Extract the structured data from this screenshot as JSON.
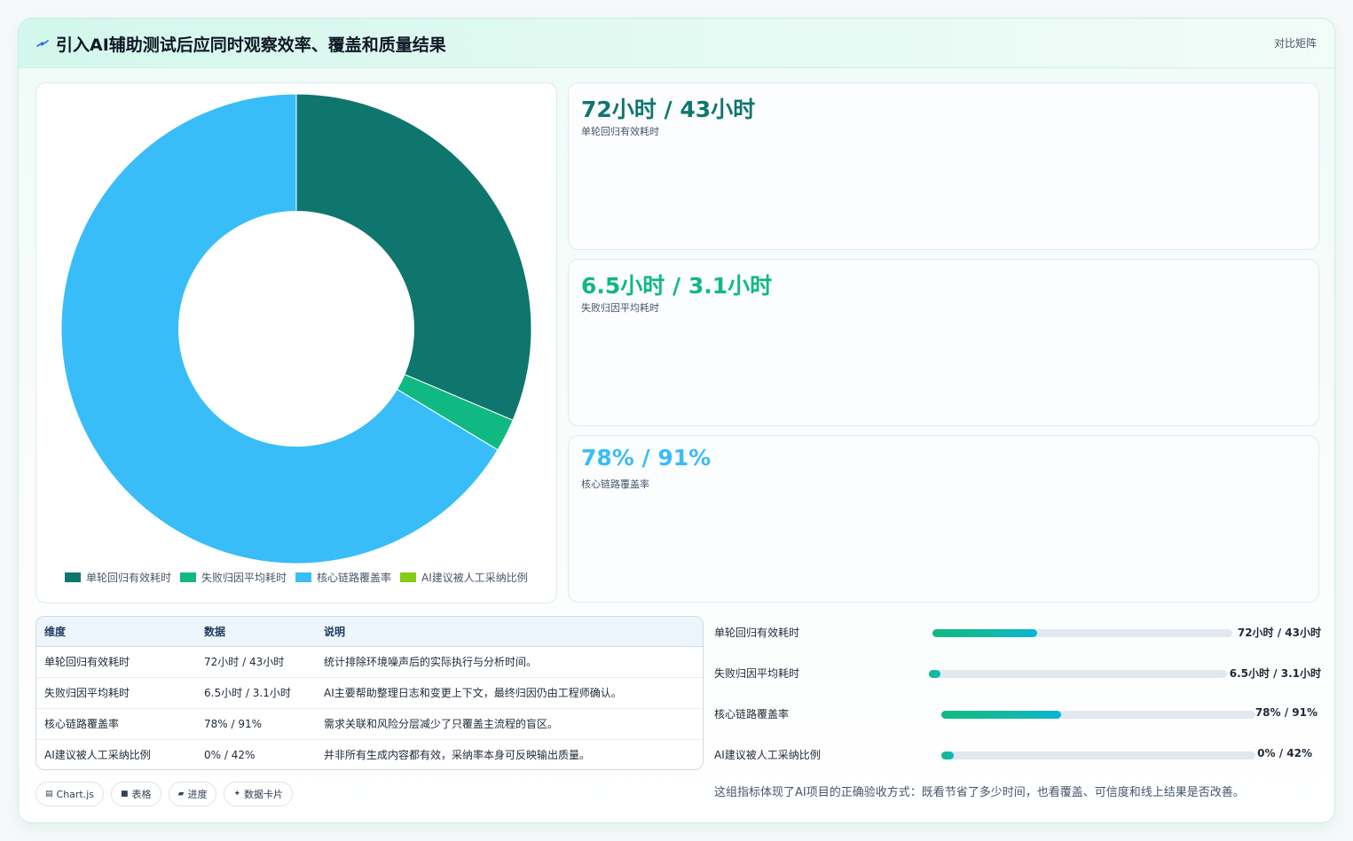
{
  "header": {
    "title": "引入AI辅助测试后应同时观察效率、覆盖和质量结果",
    "tag": "对比矩阵"
  },
  "colors": {
    "teal_dark": "#0f766e",
    "emerald": "#10b981",
    "sky": "#38bdf8",
    "lime": "#84cc16"
  },
  "chart_data": {
    "type": "pie",
    "categories": [
      "单轮回归有效耗时",
      "失败归因平均耗时",
      "核心链路覆盖率",
      "AI建议被人工采纳比例"
    ],
    "values": [
      43,
      3.1,
      91,
      0
    ],
    "colors": [
      "#0f766e",
      "#10b981",
      "#38bdf8",
      "#84cc16"
    ],
    "inner_radius_ratio": 0.5,
    "legend_position": "bottom"
  },
  "metrics": [
    {
      "value": "72小时 / 43小时",
      "label": "单轮回归有效耗时",
      "color": "#0f766e"
    },
    {
      "value": "6.5小时 / 3.1小时",
      "label": "失败归因平均耗时",
      "color": "#10b981"
    },
    {
      "value": "78% / 91%",
      "label": "核心链路覆盖率",
      "color": "#38bdf8"
    }
  ],
  "table": {
    "headers": [
      "维度",
      "数据",
      "说明"
    ],
    "rows": [
      [
        "单轮回归有效耗时",
        "72小时 / 43小时",
        "统计排除环境噪声后的实际执行与分析时间。"
      ],
      [
        "失败归因平均耗时",
        "6.5小时 / 3.1小时",
        "AI主要帮助整理日志和变更上下文，最终归因仍由工程师确认。"
      ],
      [
        "核心链路覆盖率",
        "78% / 91%",
        "需求关联和风险分层减少了只覆盖主流程的盲区。"
      ],
      [
        "AI建议被人工采纳比例",
        "0% / 42%",
        "并非所有生成内容都有效，采纳率本身可反映输出质量。"
      ]
    ]
  },
  "chips": [
    {
      "icon": "chart-icon",
      "glyph": "▤",
      "label": "Chart.js"
    },
    {
      "icon": "table-icon",
      "glyph": "■",
      "label": "表格"
    },
    {
      "icon": "progress-icon",
      "glyph": "▰",
      "label": "进度"
    },
    {
      "icon": "card-icon",
      "glyph": "✦",
      "label": "数据卡片"
    }
  ],
  "progress": [
    {
      "label": "单轮回归有效耗时",
      "value": "72小时 / 43小时",
      "fraction": 0.35
    },
    {
      "label": "失败归因平均耗时",
      "value": "6.5小时 / 3.1小时",
      "fraction": 0.04
    },
    {
      "label": "核心链路覆盖率",
      "value": "78% / 91%",
      "fraction": 0.38
    },
    {
      "label": "AI建议被人工采纳比例",
      "value": "0% / 42%",
      "fraction": 0.04
    }
  ],
  "note": "这组指标体现了AI项目的正确验收方式：既看节省了多少时间，也看覆盖、可信度和线上结果是否改善。"
}
